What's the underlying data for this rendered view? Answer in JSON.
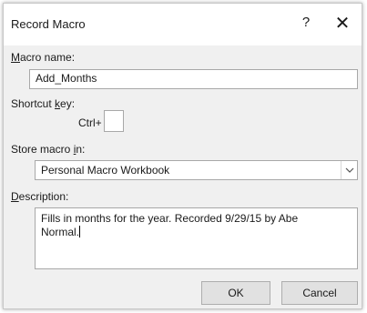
{
  "dialog": {
    "title": "Record Macro",
    "help": "?",
    "close": "✕"
  },
  "macro_name": {
    "label_first": "M",
    "label_rest": "acro name:",
    "value": "Add_Months"
  },
  "shortcut": {
    "label_pre": "Shortcut ",
    "label_u": "k",
    "label_post": "ey:",
    "ctrl_label": "Ctrl+",
    "value": ""
  },
  "store": {
    "label_pre": "Store macro ",
    "label_u": "i",
    "label_post": "n:",
    "selected": "Personal Macro Workbook"
  },
  "description": {
    "label_first": "D",
    "label_rest": "escription:",
    "value": "Fills in months for the year. Recorded 9/29/15 by Abe\nNormal."
  },
  "buttons": {
    "ok": "OK",
    "cancel": "Cancel"
  }
}
